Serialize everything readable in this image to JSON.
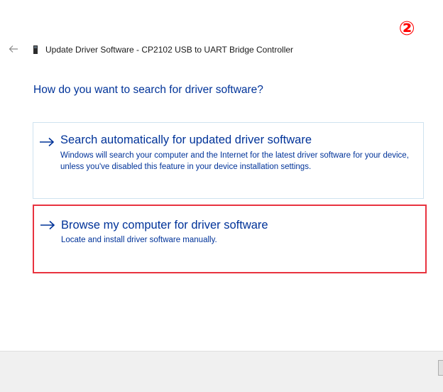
{
  "annotation": {
    "step_marker": "②",
    "highlight_color": "#e8333f"
  },
  "header": {
    "back_icon": "back-arrow-icon",
    "device_icon": "usb-device-icon",
    "title": "Update Driver Software - CP2102 USB to UART Bridge Controller"
  },
  "main": {
    "question": "How do you want to search for driver software?",
    "options": [
      {
        "icon": "arrow-right-icon",
        "title": "Search automatically for updated driver software",
        "description": "Windows will search your computer and the Internet for the latest driver software for your device, unless you've disabled this feature in your device installation settings."
      },
      {
        "icon": "arrow-right-icon",
        "title": "Browse my computer for driver software",
        "description": "Locate and install driver software manually."
      }
    ]
  },
  "colors": {
    "link_blue": "#003399",
    "accent_border": "#cfe3f0",
    "footer_bg": "#f0f0f0"
  }
}
